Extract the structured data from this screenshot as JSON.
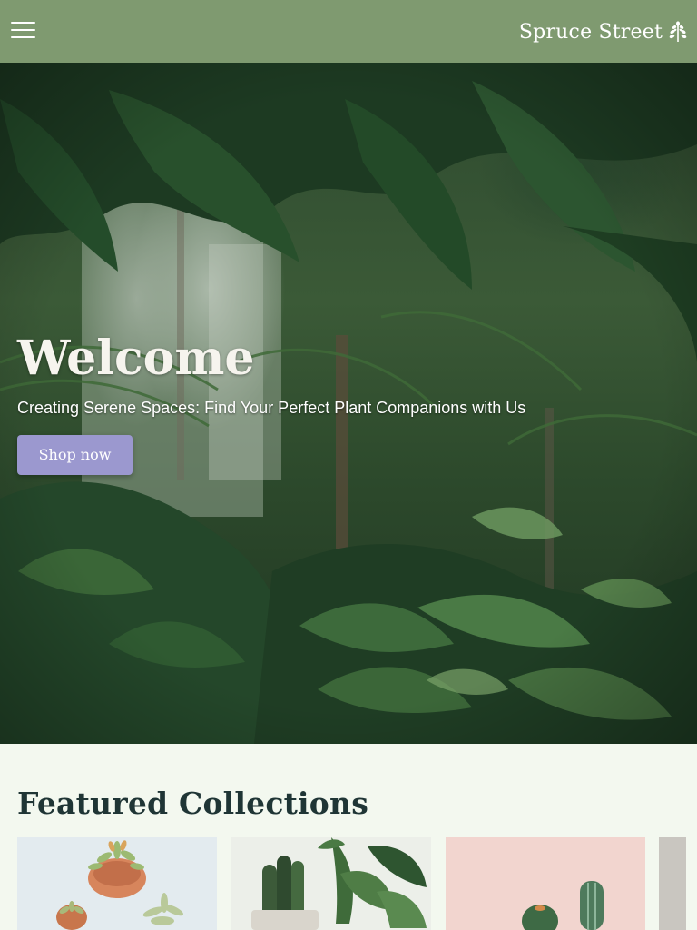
{
  "header": {
    "brand_name": "Spruce Street",
    "brand_icon": "tree-icon",
    "menu_icon": "hamburger-menu-icon",
    "background_color": "#7f9a70"
  },
  "hero": {
    "title": "Welcome",
    "subtitle": "Creating Serene Spaces: Find Your Perfect Plant Companions with Us",
    "cta_label": "Shop now",
    "cta_color": "#9b98cf"
  },
  "featured": {
    "title": "Featured Collections",
    "collections": [
      {
        "image": "succulents-in-terracotta-pots"
      },
      {
        "image": "cactus-and-leafy-plants"
      },
      {
        "image": "cacti-on-pink-background"
      },
      {
        "image": "partial-collection-card"
      }
    ]
  }
}
